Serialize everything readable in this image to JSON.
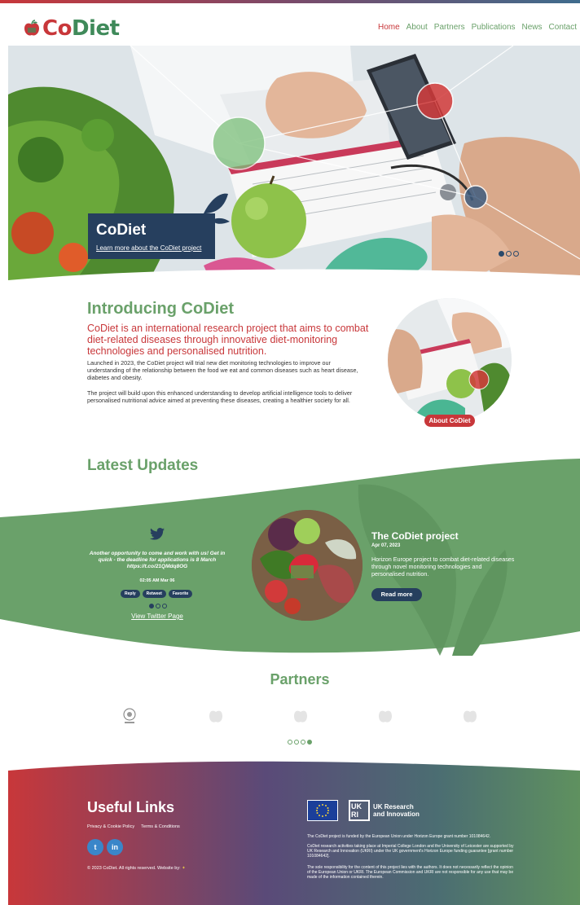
{
  "brand": {
    "name_co": "Co",
    "name_diet": "Diet"
  },
  "nav": [
    {
      "label": "Home"
    },
    {
      "label": "About"
    },
    {
      "label": "Partners"
    },
    {
      "label": "Publications"
    },
    {
      "label": "News"
    },
    {
      "label": "Contact"
    }
  ],
  "hero": {
    "title": "CoDiet",
    "link": "Learn more about the CoDiet project",
    "slides": 3,
    "active_slide": 1
  },
  "intro": {
    "heading": "Introducing CoDiet",
    "lead": "CoDiet is an international research project that aims to combat diet-related diseases through innovative diet-monitoring technologies and personalised nutrition.",
    "p1": "Launched in 2023, the CoDiet project will trial new diet monitoring technologies to improve our understanding of the relationship between the food we eat and common diseases such as heart disease, diabetes and obesity.",
    "p2": "The project will build upon this enhanced understanding to develop artificial intelligence tools to deliver personalised nutritional advice aimed at preventing these diseases, creating a healthier society for all.",
    "button": "About CoDiet"
  },
  "updates": {
    "heading": "Latest Updates",
    "tweet": {
      "text": "Another opportunity to come and work with us! Get in quick - the deadline for applications is 8 March https://t.co/21QMdq8OG",
      "time": "02:05 AM Mar 06",
      "actions": [
        "Reply",
        "Retweet",
        "Favorite"
      ],
      "link": "View Twitter Page",
      "slides": 3,
      "active_slide": 1
    },
    "news": {
      "title": "The CoDiet project",
      "date": "Apr 07, 2023",
      "desc": "Horizon Europe project to combat diet-related diseases through novel monitoring technologies and personalised nutrition.",
      "button": "Read more"
    }
  },
  "partners": {
    "heading": "Partners",
    "slides": 4,
    "active_slide": 4
  },
  "footer": {
    "heading": "Useful Links",
    "links": [
      "Privacy & Cookie Policy",
      "Terms & Conditions"
    ],
    "social": [
      "t",
      "in"
    ],
    "copyright": "© 2023 CoDiet. All rights reserved. Website by:",
    "ukri": {
      "mark": "UK RI",
      "line1": "UK Research",
      "line2": "and Innovation"
    },
    "p1": "The CoDiet project is funded by the European Union under Horizon Europe grant number 101084642.",
    "p2": "CoDiet research activities taking place at Imperial College London and the University of Leicester are supported by UK Research and Innovation (UKRI) under the UK government's Horizon Europe funding guarantee [grant number 101084642].",
    "p3": "The sole responsibility for the content of this project lies with the authors. It does not necessarily reflect the opinion of the European Union or UKRI. The European Commission and UKRI are not responsible for any use that may be made of the information contained therein."
  },
  "colors": {
    "red": "#c8373a",
    "green": "#6aa16a",
    "navy": "#263f5e"
  }
}
